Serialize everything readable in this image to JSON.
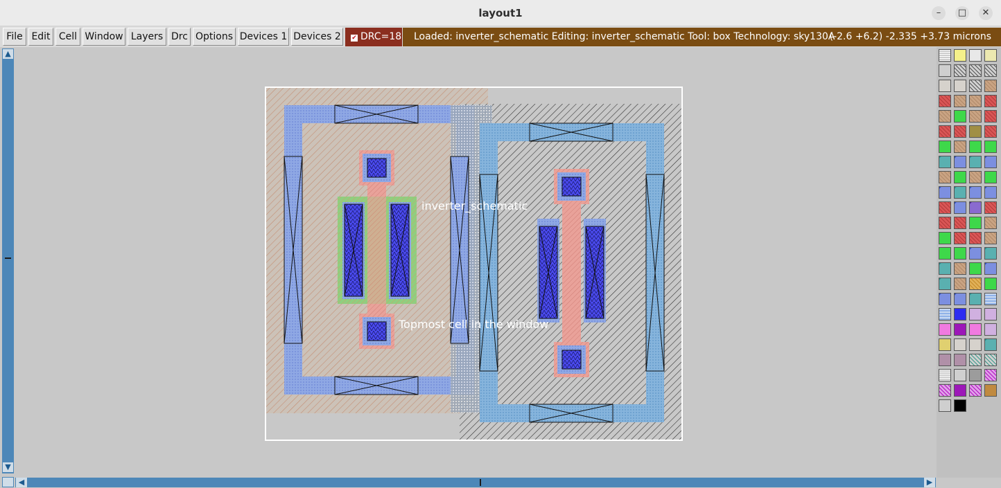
{
  "window": {
    "title": "layout1"
  },
  "menu": [
    "File",
    "Edit",
    "Cell",
    "Window",
    "Layers",
    "Drc",
    "Options",
    "Devices 1",
    "Devices 2"
  ],
  "drc": {
    "checked": true,
    "label": "DRC=18"
  },
  "status": {
    "message": "Loaded: inverter_schematic Editing: inverter_schematic Tool: box  Technology: sky130A",
    "coords": "(-2.6 +6.2) -2.335 +3.73 microns"
  },
  "canvas": {
    "cell_label": "inverter_schematic",
    "top_label": "Topmost cell in the window"
  },
  "palette": {
    "rows": [
      [
        "dots",
        "yellow",
        "box",
        "yellowbox"
      ],
      [
        "grey",
        "hatch",
        "hatch",
        "hatch"
      ],
      [
        "lgrey",
        "lgrey",
        "hatch",
        "tan"
      ],
      [
        "red",
        "tan",
        "tan",
        "red"
      ],
      [
        "tan",
        "green",
        "tan",
        "red"
      ],
      [
        "red",
        "red",
        "olive",
        "red"
      ],
      [
        "green",
        "tan",
        "green",
        "green"
      ],
      [
        "cyanx",
        "bluex",
        "cyanx",
        "bluex"
      ],
      [
        "tan",
        "green",
        "tan",
        "green"
      ],
      [
        "bluex",
        "cyanx",
        "bluex",
        "bluex"
      ],
      [
        "red",
        "bluex",
        "purplex",
        "red"
      ],
      [
        "red",
        "red",
        "green",
        "tan"
      ],
      [
        "green",
        "red",
        "red",
        "tan"
      ],
      [
        "green",
        "green",
        "bluex",
        "cyanx"
      ],
      [
        "cyanx",
        "tan",
        "green",
        "bluex"
      ],
      [
        "cyanx",
        "tan",
        "orange",
        "green"
      ],
      [
        "bluex",
        "bluex",
        "cyanx",
        "lblue"
      ],
      [
        "lblue",
        "blue",
        "lilac",
        "lilac"
      ],
      [
        "pink",
        "purple",
        "pink",
        "lilac"
      ],
      [
        "yellowdot",
        "lgrey",
        "lgrey",
        "cyanx"
      ],
      [
        "mauve",
        "mauve",
        "teal",
        "teal"
      ],
      [
        "dots",
        "grey",
        "dgrey",
        "magenta"
      ],
      [
        "magenta",
        "purple",
        "magenta",
        "brown"
      ],
      [
        "grey",
        "black"
      ]
    ]
  }
}
